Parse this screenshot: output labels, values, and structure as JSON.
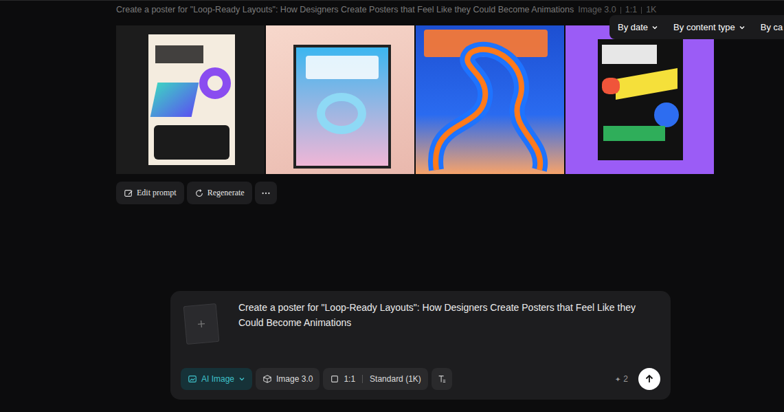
{
  "header": {
    "prompt": "Create a poster for \"Loop-Ready Layouts\": How Designers Create Posters that Feel Like they Could Become Animations",
    "meta": [
      "Image 3.0",
      "1:1",
      "1K"
    ]
  },
  "filters": [
    {
      "label": "By date",
      "chevron": true
    },
    {
      "label": "By content type",
      "chevron": true
    },
    {
      "label": "By ca",
      "chevron": false
    }
  ],
  "images": [
    {
      "kind": "cream",
      "color": "#1c1c1c"
    },
    {
      "kind": "framed",
      "color": "#f3cfc4"
    },
    {
      "kind": "swirl",
      "color": "#1d4fd1"
    },
    {
      "kind": "sticker",
      "color": "#9b5cf6"
    }
  ],
  "actions": [
    "Edit prompt",
    "Regenerate"
  ],
  "composer": {
    "prompt": "Create a poster for \"Loop-Ready Layouts\": How Designers Create Posters that Feel Like they Could Become Animations",
    "mode": "AI Image",
    "model": "Image 3.0",
    "ratio": "1:1",
    "quality": "Standard (1K)",
    "credit_icon": "✦",
    "credits": "2"
  }
}
